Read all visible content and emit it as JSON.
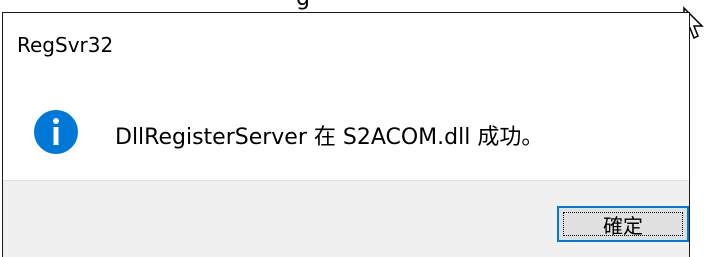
{
  "window": {
    "title_fragment": "g"
  },
  "dialog": {
    "title": "RegSvr32",
    "message": "DllRegisterServer 在 S2ACOM.dll 成功。",
    "icon": "info-icon",
    "ok_label": "確定"
  },
  "colors": {
    "icon_blue": "#0078d7",
    "footer_bg": "#f0f0f0",
    "button_bg": "#e1e1e1",
    "focus_border": "#0078d7"
  }
}
